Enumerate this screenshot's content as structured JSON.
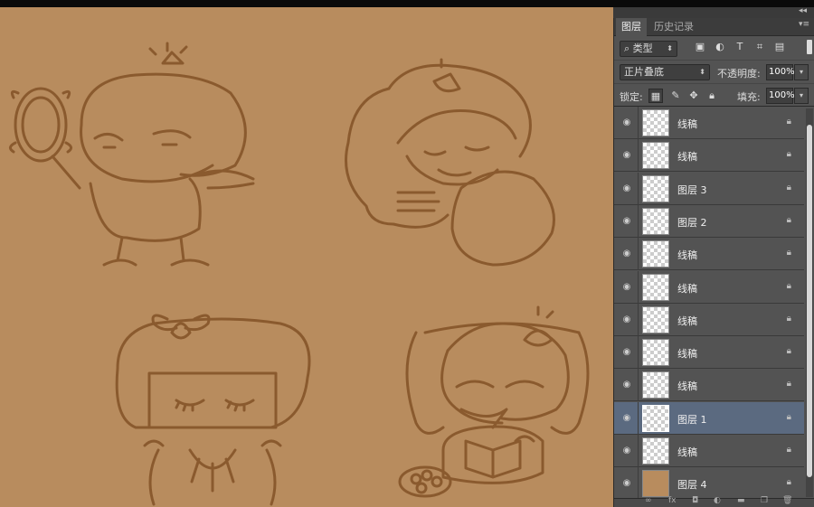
{
  "panel": {
    "tabs": [
      {
        "label": "图层",
        "active": true
      },
      {
        "label": "历史记录",
        "active": false
      }
    ],
    "filter": {
      "kind": "类型",
      "icons": [
        "image-filter-icon",
        "adjustment-filter-icon",
        "text-filter-icon",
        "shape-filter-icon",
        "smart-object-filter-icon"
      ]
    },
    "blend": {
      "mode": "正片叠底",
      "opacity_label": "不透明度:",
      "opacity": "100%"
    },
    "lock": {
      "label": "锁定:",
      "fill_label": "填充:",
      "fill": "100%"
    },
    "layers": [
      {
        "name": "线稿",
        "selected": false,
        "thumb": "transparent"
      },
      {
        "name": "线稿",
        "selected": false,
        "thumb": "transparent"
      },
      {
        "name": "图层 3",
        "selected": false,
        "thumb": "transparent"
      },
      {
        "name": "图层 2",
        "selected": false,
        "thumb": "transparent"
      },
      {
        "name": "线稿",
        "selected": false,
        "thumb": "transparent"
      },
      {
        "name": "线稿",
        "selected": false,
        "thumb": "transparent"
      },
      {
        "name": "线稿",
        "selected": false,
        "thumb": "transparent"
      },
      {
        "name": "线稿",
        "selected": false,
        "thumb": "transparent"
      },
      {
        "name": "线稿",
        "selected": false,
        "thumb": "transparent"
      },
      {
        "name": "图层 1",
        "selected": true,
        "thumb": "transparent"
      },
      {
        "name": "线稿",
        "selected": false,
        "thumb": "transparent"
      },
      {
        "name": "图层 4",
        "selected": false,
        "thumb": "fill"
      }
    ],
    "footer_icons": [
      "link-icon",
      "fx-icon",
      "mask-icon",
      "adjustment-icon",
      "folder-icon",
      "new-layer-icon",
      "trash-icon"
    ]
  },
  "colors": {
    "canvas_bg": "#b88c5e",
    "line": "#8a5a2e",
    "panel_bg": "#535353",
    "selected_row": "#5b6a80"
  }
}
